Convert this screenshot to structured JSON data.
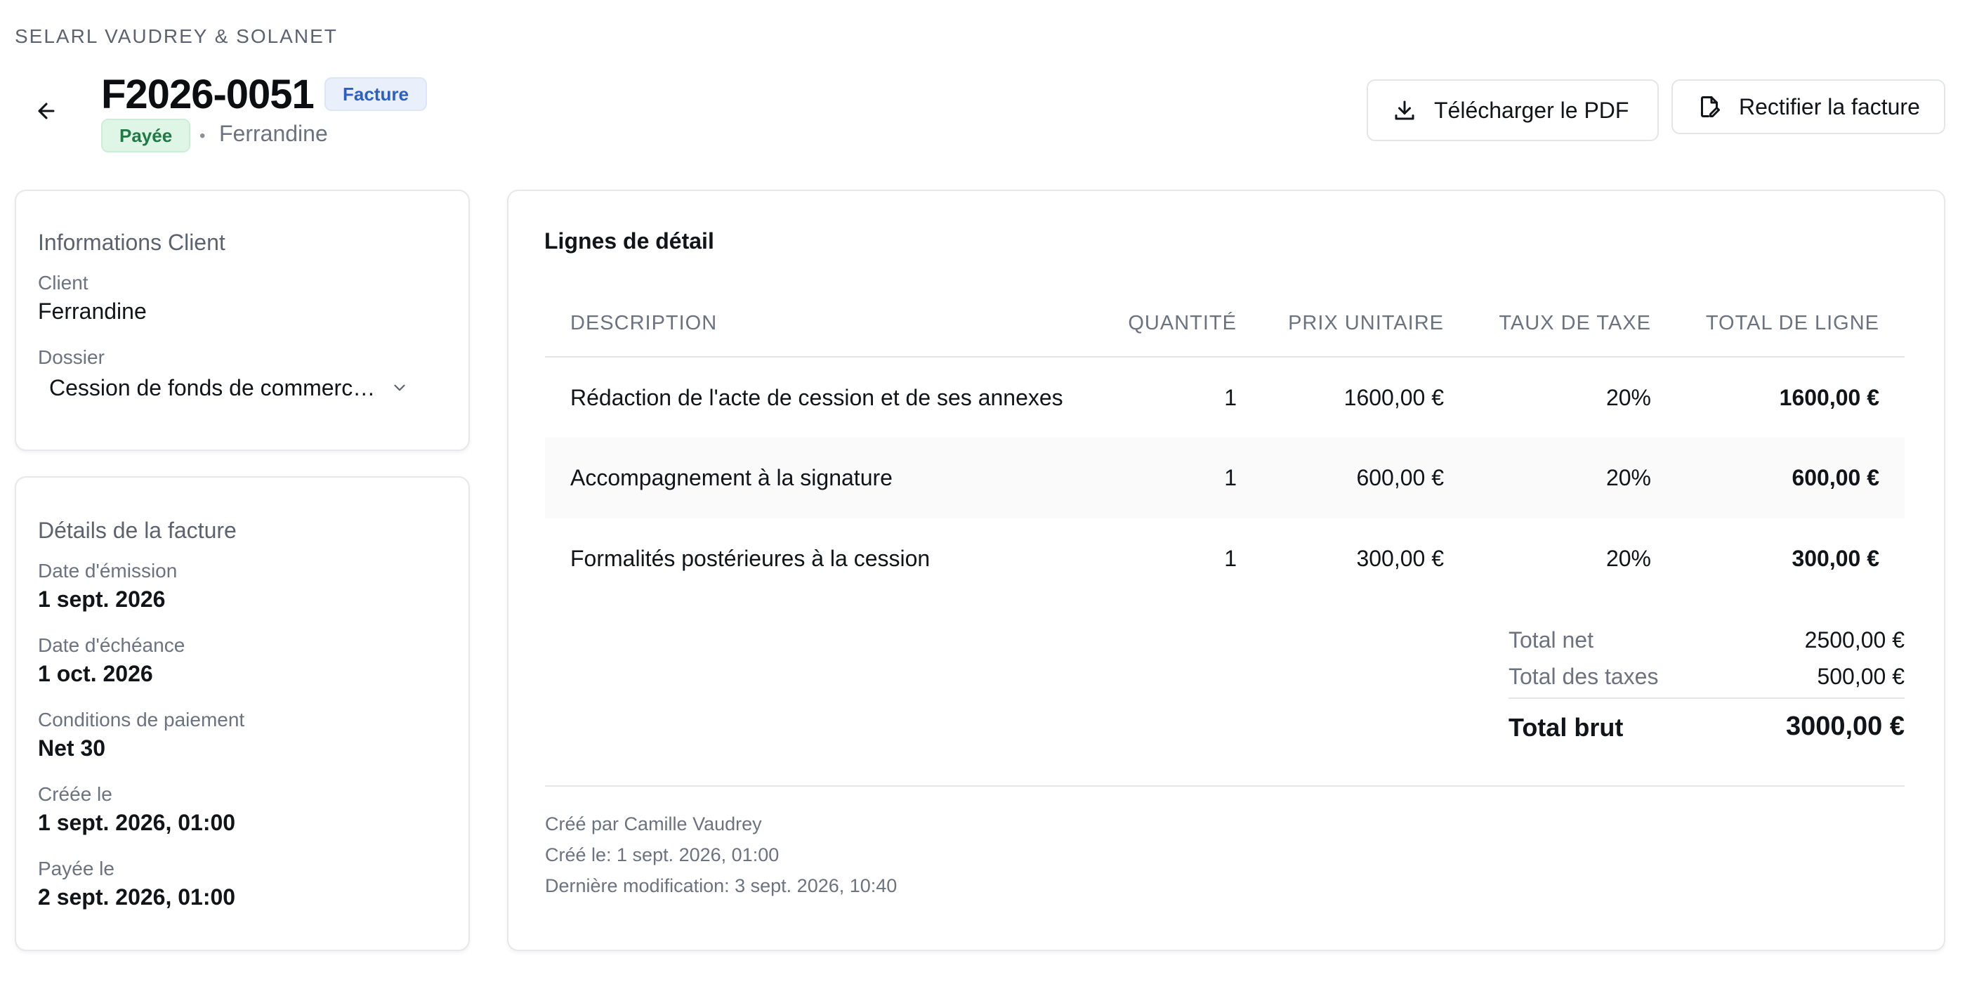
{
  "firm_name": "SELARL VAUDREY & SOLANET",
  "invoice": {
    "number": "F2026-0051",
    "type_badge": "Facture",
    "status": "Payée",
    "client": "Ferrandine"
  },
  "actions": {
    "download_pdf": "Télécharger le PDF",
    "rectify": "Rectifier la facture"
  },
  "client_card": {
    "title": "Informations Client",
    "client_label": "Client",
    "client_value": "Ferrandine",
    "dossier_label": "Dossier",
    "dossier_value": "Cession de fonds de commerce…"
  },
  "details_card": {
    "title": "Détails de la facture",
    "fields": [
      {
        "label": "Date d'émission",
        "value": "1 sept. 2026"
      },
      {
        "label": "Date d'échéance",
        "value": "1 oct. 2026"
      },
      {
        "label": "Conditions de paiement",
        "value": "Net 30"
      },
      {
        "label": "Créée le",
        "value": "1 sept. 2026, 01:00"
      },
      {
        "label": "Payée le",
        "value": "2 sept. 2026, 01:00"
      }
    ]
  },
  "lines": {
    "title": "Lignes de détail",
    "columns": [
      "DESCRIPTION",
      "QUANTITÉ",
      "PRIX UNITAIRE",
      "TAUX DE TAXE",
      "TOTAL DE LIGNE"
    ],
    "rows": [
      {
        "description": "Rédaction de l'acte de cession et de ses annexes",
        "qty": "1",
        "unit_price": "1600,00 €",
        "tax": "20%",
        "total": "1600,00 €"
      },
      {
        "description": "Accompagnement à la signature",
        "qty": "1",
        "unit_price": "600,00 €",
        "tax": "20%",
        "total": "600,00 €"
      },
      {
        "description": "Formalités postérieures à la cession",
        "qty": "1",
        "unit_price": "300,00 €",
        "tax": "20%",
        "total": "300,00 €"
      }
    ]
  },
  "totals": {
    "net_label": "Total net",
    "net_value": "2500,00 €",
    "tax_label": "Total des taxes",
    "tax_value": "500,00 €",
    "gross_label": "Total brut",
    "gross_value": "3000,00 €"
  },
  "meta": {
    "created_by": "Créé par Camille Vaudrey",
    "created_on": "Créé le: 1 sept. 2026, 01:00",
    "modified": "Dernière modification: 3 sept. 2026, 10:40"
  },
  "icons": {
    "back": "arrow-left-icon",
    "download": "download-icon",
    "rectify": "file-edit-icon",
    "dossier": "chevron-down-icon"
  },
  "colors": {
    "type_badge_text": "#2b5fc4",
    "type_badge_bg": "#eaf0fb",
    "status_text": "#1f7a45",
    "status_bg": "#dff5e6"
  }
}
